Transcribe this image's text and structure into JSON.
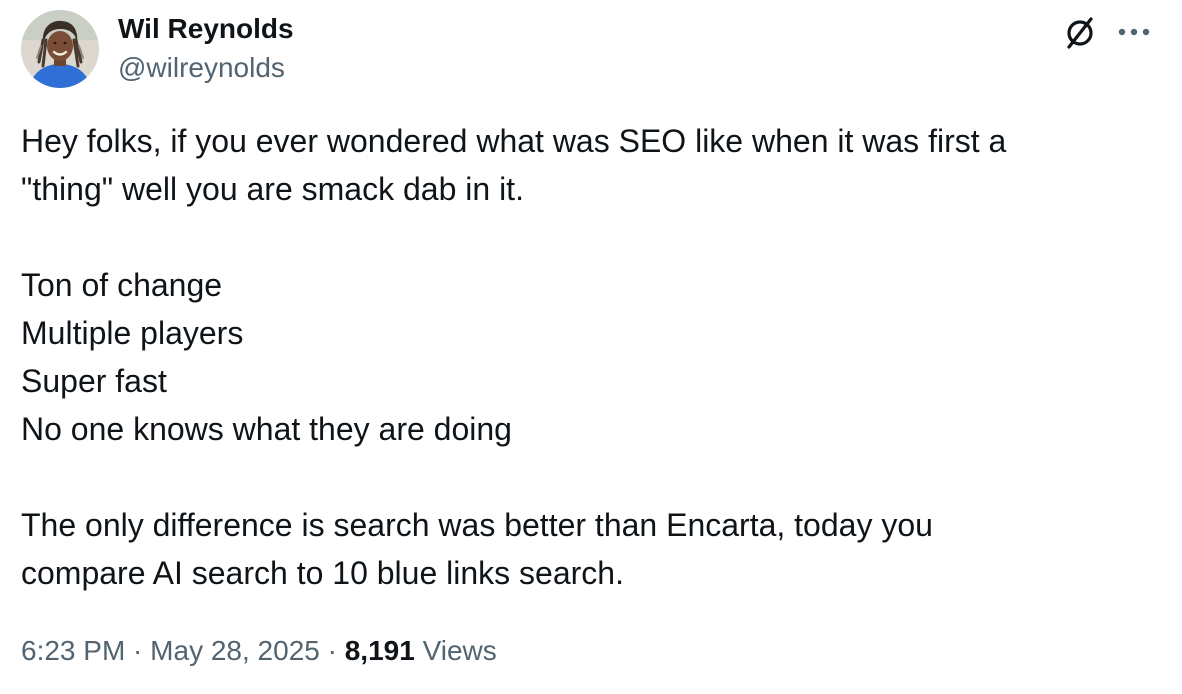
{
  "author": {
    "display_name": "Wil Reynolds",
    "handle": "@wilreynolds"
  },
  "icons": {
    "grok": "grok-slash-icon",
    "more": "more-horizontal-icon"
  },
  "tweet": {
    "lines": [
      "Hey folks, if you ever wondered what was SEO like when it was first a",
      "\"thing\" well you are smack dab in it.",
      "",
      "Ton of change",
      "Multiple players",
      "Super fast",
      "No one knows what they are doing",
      "",
      "The only difference is search was better than Encarta, today you",
      "compare AI search to 10 blue links search."
    ]
  },
  "meta": {
    "time": "6:23 PM",
    "separator": " · ",
    "date": "May 28, 2025",
    "views_count": "8,191",
    "views_label": "Views"
  },
  "colors": {
    "text_primary": "#0f1419",
    "text_secondary": "#536471",
    "background": "#ffffff"
  }
}
